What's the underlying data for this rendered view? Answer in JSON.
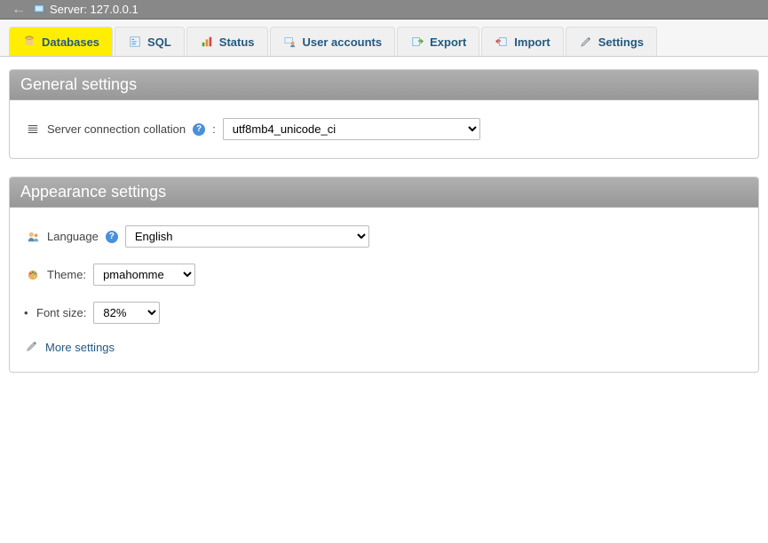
{
  "topbar": {
    "server_label": "Server: 127.0.0.1"
  },
  "tabs": {
    "databases": "Databases",
    "sql": "SQL",
    "status": "Status",
    "user_accounts": "User accounts",
    "export": "Export",
    "import": "Import",
    "settings": "Settings"
  },
  "general": {
    "title": "General settings",
    "collation_label": "Server connection collation",
    "collation_value": "utf8mb4_unicode_ci"
  },
  "appearance": {
    "title": "Appearance settings",
    "language_label": "Language",
    "language_value": "English",
    "theme_label": "Theme:",
    "theme_value": "pmahomme",
    "fontsize_label": "Font size:",
    "fontsize_value": "82%",
    "more_settings": "More settings"
  }
}
